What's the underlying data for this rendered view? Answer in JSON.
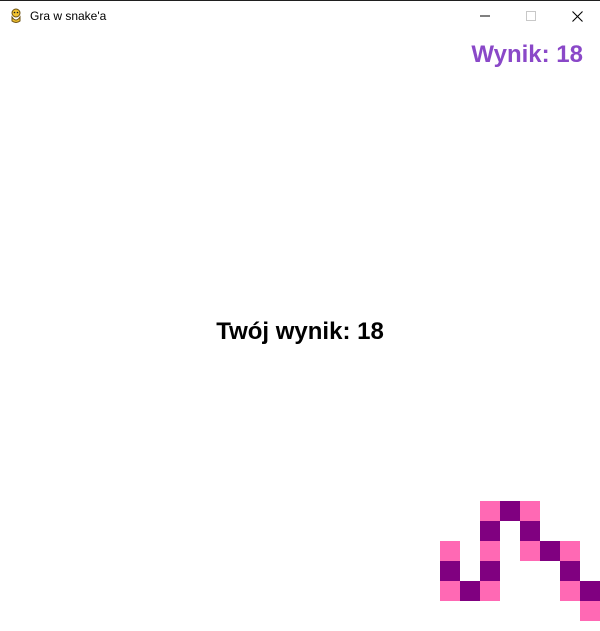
{
  "window": {
    "title": "Gra w snake'a"
  },
  "game": {
    "score_label": "Wynik: 18",
    "final_label": "Twój wynik: 18",
    "score": 18,
    "colors": {
      "score_text": "#8a48c8",
      "final_text": "#000000",
      "segment_light": "#ff69b4",
      "segment_dark": "#800080",
      "background": "#ffffff"
    },
    "grid_cell": 20,
    "snake_segments": [
      {
        "col": 24,
        "row": 24,
        "shade": "light"
      },
      {
        "col": 25,
        "row": 24,
        "shade": "dark"
      },
      {
        "col": 26,
        "row": 24,
        "shade": "light"
      },
      {
        "col": 24,
        "row": 25,
        "shade": "dark"
      },
      {
        "col": 26,
        "row": 25,
        "shade": "dark"
      },
      {
        "col": 22,
        "row": 26,
        "shade": "light"
      },
      {
        "col": 24,
        "row": 26,
        "shade": "light"
      },
      {
        "col": 26,
        "row": 26,
        "shade": "light"
      },
      {
        "col": 27,
        "row": 26,
        "shade": "dark"
      },
      {
        "col": 28,
        "row": 26,
        "shade": "light"
      },
      {
        "col": 22,
        "row": 27,
        "shade": "dark"
      },
      {
        "col": 24,
        "row": 27,
        "shade": "dark"
      },
      {
        "col": 28,
        "row": 27,
        "shade": "dark"
      },
      {
        "col": 22,
        "row": 28,
        "shade": "light"
      },
      {
        "col": 23,
        "row": 28,
        "shade": "dark"
      },
      {
        "col": 24,
        "row": 28,
        "shade": "light"
      },
      {
        "col": 28,
        "row": 28,
        "shade": "light"
      },
      {
        "col": 29,
        "row": 28,
        "shade": "dark"
      },
      {
        "col": 29,
        "row": 29,
        "shade": "light"
      }
    ]
  }
}
